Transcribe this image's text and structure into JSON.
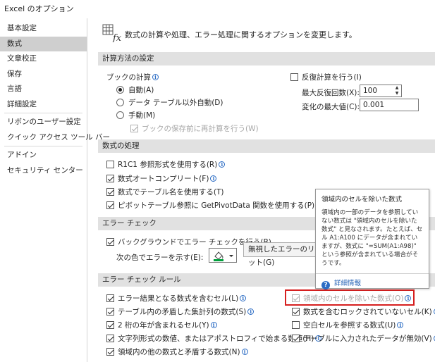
{
  "window": {
    "title": "Excel のオプション"
  },
  "sidebar": {
    "items": [
      {
        "label": "基本設定",
        "selected": false
      },
      {
        "label": "数式",
        "selected": true
      },
      {
        "label": "文章校正",
        "selected": false
      },
      {
        "label": "保存",
        "selected": false
      },
      {
        "label": "言語",
        "selected": false
      },
      {
        "label": "詳細設定",
        "selected": false
      },
      {
        "label": "リボンのユーザー設定",
        "selected": false
      },
      {
        "label": "クイック アクセス ツール バー",
        "selected": false
      },
      {
        "label": "アドイン",
        "selected": false
      },
      {
        "label": "セキュリティ センター",
        "selected": false
      }
    ]
  },
  "header": {
    "icon": "formula-fx-icon",
    "text": "数式の計算や処理、エラー処理に関するオプションを変更します。"
  },
  "calc": {
    "title": "計算方法の設定",
    "workbook_label": "ブックの計算",
    "radio_auto": "自動(A)",
    "radio_auto_except": "データ テーブル以外自動(D)",
    "radio_manual": "手動(M)",
    "recalc_before_save": "ブックの保存前に再計算を行う(W)",
    "iterative": "反復計算を行う(I)",
    "max_iter_label": "最大反復回数(X):",
    "max_iter_value": "100",
    "max_change_label": "変化の最大値(C):",
    "max_change_value": "0.001"
  },
  "formulas": {
    "title": "数式の処理",
    "r1c1": "R1C1 参照形式を使用する(R)",
    "autocomplete": "数式オートコンプリート(F)",
    "table_names": "数式でテーブル名を使用する(T)",
    "getpivotdata": "ピボットテーブル参照に GetPivotData 関数を使用する(P)"
  },
  "errorcheck": {
    "title": "エラー チェック",
    "background": "バックグラウンドでエラー チェックを行う(B)",
    "color_label": "次の色でエラーを示す(E):",
    "reset_button": "無視したエラーのリセット(G)"
  },
  "rules": {
    "title": "エラー チェック ルール",
    "left": [
      {
        "label": "エラー結果となる数式を含むセル(L)",
        "checked": true
      },
      {
        "label": "テーブル内の矛盾した集計列の数式(S)",
        "checked": true
      },
      {
        "label": "2 桁の年が含まれるセル(Y)",
        "checked": true
      },
      {
        "label": "文字列形式の数値、またはアポストロフィで始まる数値(H)",
        "checked": true
      },
      {
        "label": "領域内の他の数式と矛盾する数式(N)",
        "checked": true
      }
    ],
    "right": [
      {
        "label": "領域内のセルを除いた数式(O)",
        "checked": true,
        "disabled": true
      },
      {
        "label": "数式を含むロックされていないセル(K)",
        "checked": true,
        "disabled": false
      },
      {
        "label": "空白セルを参照する数式(U)",
        "checked": false,
        "disabled": false
      },
      {
        "label": "テーブルに入力されたデータが無効(V)",
        "checked": true,
        "disabled": false
      }
    ]
  },
  "tooltip": {
    "title": "領域内のセルを除いた数式",
    "body": "領域内の一部のデータを参照していない数式は \"領域内のセルを除いた数式\" と見なされます。たとえば、セル A1:A100 にデータが含まれていますが、数式に \"=SUM(A1:A98)\" という参照が含まれている場合がそうです。",
    "link": "詳細情報"
  },
  "colors": {
    "highlight": "#d61f1f",
    "selected_nav": "#cfcfcf",
    "section_bg": "#e1e1e1",
    "link": "#1f5fb4"
  }
}
